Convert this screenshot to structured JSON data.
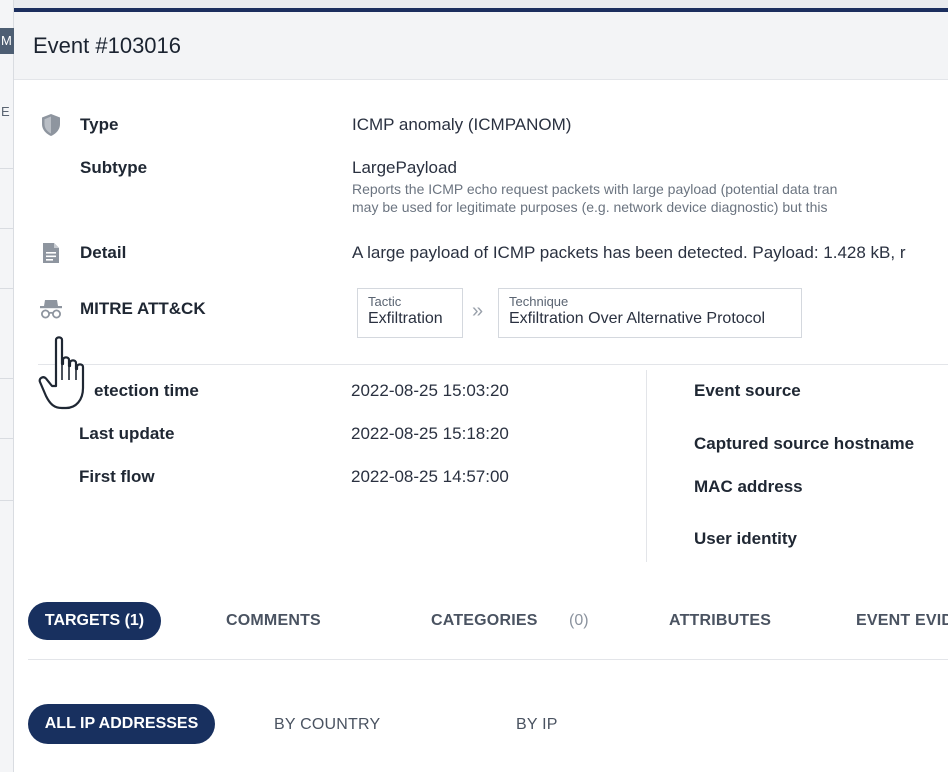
{
  "background": {
    "tab_letter": "M",
    "side_letter": "E"
  },
  "modal": {
    "title": "Event #103016"
  },
  "details": {
    "type_label": "Type",
    "type_value": "ICMP anomaly (ICMPANOM)",
    "subtype_label": "Subtype",
    "subtype_value": "LargePayload",
    "subtype_desc_line1": "Reports the ICMP echo request packets with large payload (potential data tran",
    "subtype_desc_line2": "may be used for legitimate purposes (e.g. network device diagnostic) but this",
    "detail_label": "Detail",
    "detail_value": "A large payload of ICMP packets has been detected. Payload: 1.428 kB, r",
    "mitre_label": "MITRE ATT&CK",
    "tactic_caption": "Tactic",
    "tactic_value": "Exfiltration",
    "chevron": "»",
    "technique_caption": "Technique",
    "technique_value": "Exfiltration Over Alternative Protocol"
  },
  "times": {
    "detection_label": "etection time",
    "detection_value": "2022-08-25 15:03:20",
    "last_update_label": "Last update",
    "last_update_value": "2022-08-25 15:18:20",
    "first_flow_label": "First flow",
    "first_flow_value": "2022-08-25 14:57:00"
  },
  "source": {
    "event_source_label": "Event source",
    "hostname_label": "Captured source hostname",
    "mac_label": "MAC address",
    "user_identity_label": "User identity"
  },
  "tabs": {
    "targets": "TARGETS (1)",
    "comments": "COMMENTS",
    "categories": "CATEGORIES",
    "categories_count": "(0)",
    "attributes": "ATTRIBUTES",
    "event_evidence": "EVENT EVID"
  },
  "subtabs": {
    "all_ip": "ALL IP ADDRESSES",
    "by_country": "BY COUNTRY",
    "by_ip": "BY IP"
  },
  "colors": {
    "accent": "#18305f",
    "header_bg": "#f3f4f6"
  },
  "icons": {
    "type": "shield-icon",
    "detail": "document-icon",
    "mitre": "spy-icon",
    "cursor": "hand-pointer-icon"
  }
}
